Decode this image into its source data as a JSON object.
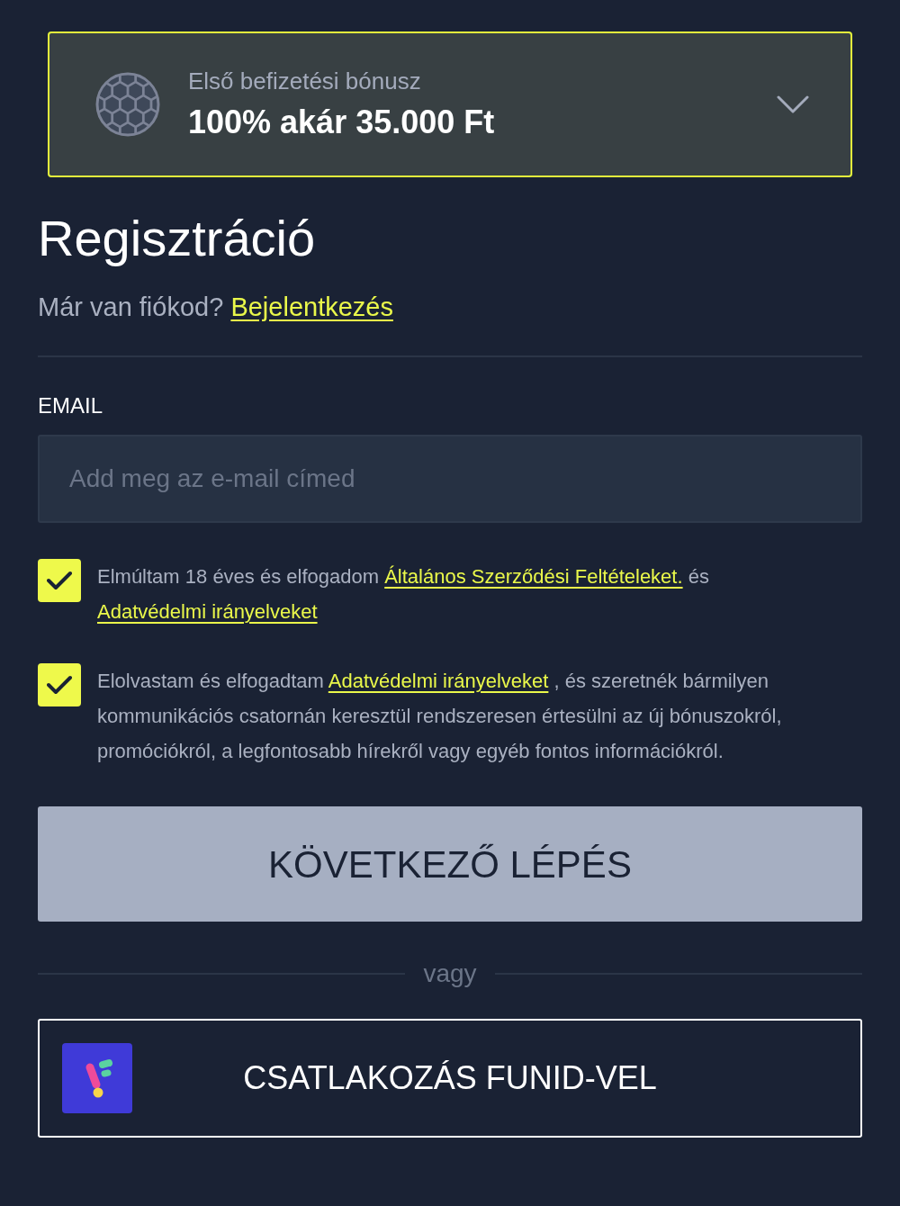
{
  "bonus_card": {
    "label": "Első befizetési bónusz",
    "amount": "100% akár 35.000 Ft",
    "expanded": false
  },
  "heading": "Regisztráció",
  "login_prompt": {
    "text": "Már van fiókod?",
    "link": "Bejelentkezés"
  },
  "email_field": {
    "label": "EMAIL",
    "placeholder": "Add meg az e-mail címed"
  },
  "consents": [
    {
      "checked": true,
      "parts": [
        {
          "kind": "text",
          "text": "Elmúltam 18 éves és elfogadom"
        },
        {
          "kind": "link",
          "text": "Általános Szerződési Feltételeket."
        },
        {
          "kind": "text",
          "text": "és"
        },
        {
          "kind": "link",
          "text": "Adatvédelmi irányelveket"
        }
      ]
    },
    {
      "checked": true,
      "parts": [
        {
          "kind": "text",
          "text": "Elolvastam és elfogadtam"
        },
        {
          "kind": "link",
          "text": "Adatvédelmi irányelveket"
        },
        {
          "kind": "text",
          "text": ", és szeretnék bármilyen kommunikációs csatornán keresztül rendszeresen értesülni az új bónuszokról, promóciókról, a legfontosabb hírekről vagy egyéb fontos információkról."
        }
      ]
    }
  ],
  "next_button": {
    "label": "KÖVETKEZŐ LÉPÉS",
    "disabled": true
  },
  "divider": {
    "text": "vagy"
  },
  "funid_button": {
    "label": "CSATLAKOZÁS FUNID-VEL"
  }
}
